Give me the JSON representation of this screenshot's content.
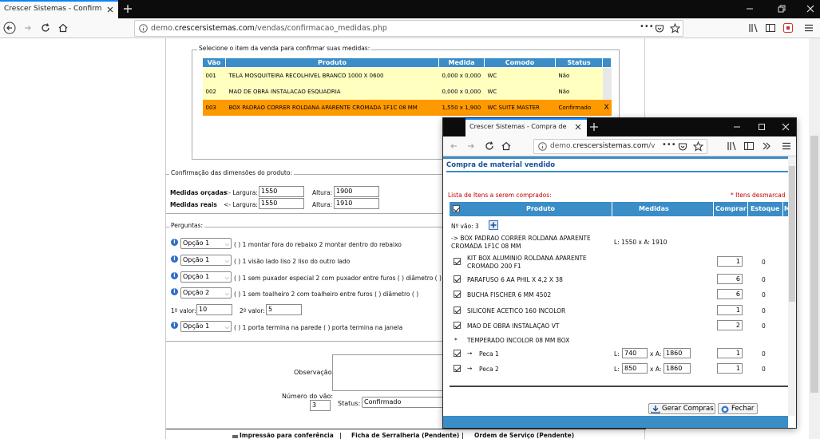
{
  "browser": {
    "tab_title": "Crescer Sistemas - Confirmação de",
    "url_prefix": "demo.",
    "url_host": "crescersistemas.com",
    "url_path": "/vendas/confirmacao_medidas.php",
    "url_dots": "•••"
  },
  "items_section": {
    "legend": "Selecione o item da venda para confirmar suas medidas:",
    "columns": [
      "Vão",
      "Produto",
      "Medida",
      "Comodo",
      "Status"
    ],
    "rows": [
      {
        "vao": "001",
        "produto": "TELA MOSQUITEIRA RECOLHIVEL BRANCO 1000 X 0600",
        "medida": "0,000 x 0,000",
        "comodo": "WC",
        "status": "Não",
        "x": ""
      },
      {
        "vao": "002",
        "produto": "MAO DE OBRA INSTALACAO ESQUADRIA",
        "medida": "0,000 x 0,000",
        "comodo": "WC",
        "status": "Não",
        "x": ""
      },
      {
        "vao": "003",
        "produto": "BOX PADRAO CORRER ROLDANA APARENTE CROMADA 1F1C 08 MM",
        "medida": "1,550 x 1,900",
        "comodo": "WC SUITE MASTER",
        "status": "Confirmado",
        "x": "X"
      }
    ],
    "colors": {
      "header": "#3a8dc6",
      "row": "#ffffc0",
      "selected": "#ff9900"
    }
  },
  "dimensions": {
    "legend": "Confirmação das dimensões do produto:",
    "orcadas_label": "Medidas orçadas",
    "reais_label": "Medidas reais",
    "largura_label": "<- Largura:",
    "altura_label": "Altura:",
    "orcadas_largura": "1550",
    "orcadas_altura": "1900",
    "reais_largura": "1550",
    "reais_altura": "1910"
  },
  "questions": {
    "legend": "Perguntas:",
    "items": [
      {
        "option": "Opção 1",
        "text": "( ) 1 montar fora do rebaixo 2 montar dentro do rebaixo"
      },
      {
        "option": "Opção 1",
        "text": "( ) 1 visão lado liso 2 liso do outro lado"
      },
      {
        "option": "Opção 1",
        "text": "( ) 1 sem puxador especial 2 com puxador entre furos ( ) diâmetro ( )"
      },
      {
        "option": "Opção 2",
        "text": "( ) 1 sem toalheiro 2 com toalheiro entre furos ( ) diâmetro ( )"
      },
      {
        "option": "Opção 1",
        "text": "( ) 1 porta termina na parede ( ) porta termina na janela"
      }
    ],
    "valor1_label": "1º valor:",
    "valor1": "10",
    "valor2_label": "2º valor:",
    "valor2": "5"
  },
  "footer_form": {
    "observacao_label": "Observação:",
    "numero_vao_label": "Número do vão:",
    "numero_vao": "3",
    "status_label": "Status:",
    "status_value": "Confirmado"
  },
  "bottom_links": {
    "impressao": "Impressão para conferência",
    "ficha": "Ficha de Serralheria (Pendente)",
    "ordem": "Ordem de Serviço (Pendente)"
  },
  "popup": {
    "tab_title": "Crescer Sistemas - Compra de mate",
    "url_prefix": "demo.",
    "url_host": "crescersistemas.com",
    "url_path": "/v",
    "url_dots": "•••",
    "header": "Compra de material vendido",
    "list_title": "Lista de Itens a serem comprados:",
    "unchecked_note": "* Itens desmarcad",
    "columns": {
      "produto": "Produto",
      "medidas": "Medidas",
      "comprar": "Comprar",
      "estoque": "Estoque",
      "m": "M"
    },
    "vao_label": "Nº vão: 3",
    "parent": {
      "produto": "-> BOX PADRAO CORRER ROLDANA APARENTE CROMADA 1F1C 08 MM",
      "medidas": "L: 1550 x A: 1910"
    },
    "items": [
      {
        "produto": "KIT BOX ALUMINIO ROLDANA APARENTE CROMADO 200 F1",
        "comprar": "1",
        "estoque": "0"
      },
      {
        "produto": "PARAFUSO 6 AA PHIL X 4,2 X 38",
        "comprar": "6",
        "estoque": "0"
      },
      {
        "produto": "BUCHA FISCHER 6 MM 4502",
        "comprar": "6",
        "estoque": "0"
      },
      {
        "produto": "SILICONE ACETICO 160 INCOLOR",
        "comprar": "1",
        "estoque": "0"
      },
      {
        "produto": "MAO DE OBRA INSTALAÇAO VT",
        "comprar": "2",
        "estoque": "0"
      }
    ],
    "temperado": {
      "marker": "*",
      "produto": "TEMPERADO INCOLOR 08 MM BOX"
    },
    "pecas": [
      {
        "arrow": "→",
        "produto": "Peca 1",
        "l_label": "L:",
        "l": "740",
        "a_label": "x A:",
        "a": "1860",
        "comprar": "1",
        "estoque": "0"
      },
      {
        "arrow": "→",
        "produto": "Peca 2",
        "l_label": "L:",
        "l": "850",
        "a_label": "x A:",
        "a": "1860",
        "comprar": "1",
        "estoque": "0"
      }
    ],
    "buttons": {
      "gerar": "Gerar Compras",
      "fechar": "Fechar"
    }
  }
}
